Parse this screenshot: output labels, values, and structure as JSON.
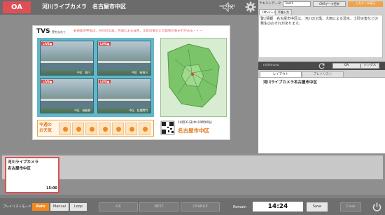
{
  "header": {
    "oa_badge": "OA",
    "title": "河川ライブカメラ　名古屋市中区",
    "version": "ver 1.0.11"
  },
  "preview": {
    "logo": "TVS",
    "logo_sub": "昼を忘れて",
    "ticker": "名古屋市中区は、河川の氾濫、大雨による浸水、土砂災害などの発生のおそれがある・・・",
    "cameras": [
      {
        "live": "LIVE●",
        "location": "中区　堀川"
      },
      {
        "live": "LIVE●",
        "location": "中区　新堀川"
      },
      {
        "live": "LIVE●",
        "location": "中区　納屋橋"
      },
      {
        "live": "LIVE●",
        "location": "中区　松重閘門"
      }
    ],
    "weather_label": "今週の\nお天気",
    "date_line": "10月31日(木)10時00分",
    "city": "名古屋市中区"
  },
  "right_panel": {
    "text_data_label": "テキストデータ",
    "text_data_select": "Text1",
    "cms_button": "CMSデータ更新",
    "take_button": "入力データ表示",
    "tabs": [
      "CMSデータ",
      "手書入力"
    ],
    "text_content": "警2情報　名古屋市中区は、河川の氾濫、大雨による浸水、土砂災害などの発生のおそれがあります。",
    "mid_label": "nishimura",
    "oa_button": "OA",
    "single_button": "シングル",
    "layout_tab": "レイアウト",
    "playlist_tab": "プレイリスト",
    "layout_item": "河川ライブカメラ名古屋市中区"
  },
  "schedule": {
    "card_title_1": "河川ライブカメラ",
    "card_title_2": "名古屋市中区",
    "card_time": "15:00"
  },
  "controls": {
    "playlist_mode_label": "プレイリストモード",
    "auto": "Auto",
    "manual": "Manual",
    "loop": "Loop",
    "oa": "OA",
    "next": "NEXT",
    "change": "CHANGE",
    "remain_label": "Remain",
    "remain_time": "14:24",
    "save": "Save",
    "clear": "Clear"
  },
  "colors": {
    "accent_red": "#e04f55",
    "accent_orange": "#f08a20"
  }
}
